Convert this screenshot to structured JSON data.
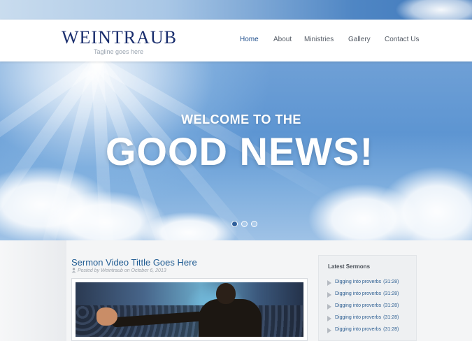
{
  "header": {
    "logo": "WEINTRAUB",
    "tagline": "Tagline goes here",
    "nav": [
      "Home",
      "About",
      "Ministries",
      "Gallery",
      "Contact Us"
    ],
    "active_nav": "Home"
  },
  "hero": {
    "subtitle": "WELCOME TO THE",
    "title": "GOOD NEWS!",
    "slides": {
      "count": 3,
      "active": 1
    }
  },
  "post": {
    "title": "Sermon Video Tittle Goes Here",
    "meta": "Posted by Weintraub on October 6, 2013"
  },
  "sidebar": {
    "title": "Latest Sermons",
    "items": [
      {
        "label": "Digging into proverbs",
        "duration": "(31:28)"
      },
      {
        "label": "Digging into proverbs",
        "duration": "(31:28)"
      },
      {
        "label": "Digging into proverbs",
        "duration": "(31:28)"
      },
      {
        "label": "Digging into proverbs",
        "duration": "(31:28)"
      },
      {
        "label": "Digging into proverbs",
        "duration": "(31:28)"
      }
    ]
  },
  "colors": {
    "brand": "#1a2e6e",
    "link": "#1f5b92",
    "active_dot": "#2f5f9b"
  },
  "icons": {
    "meta": "user-icon",
    "sermon_bullet": "arrow-right-icon"
  }
}
